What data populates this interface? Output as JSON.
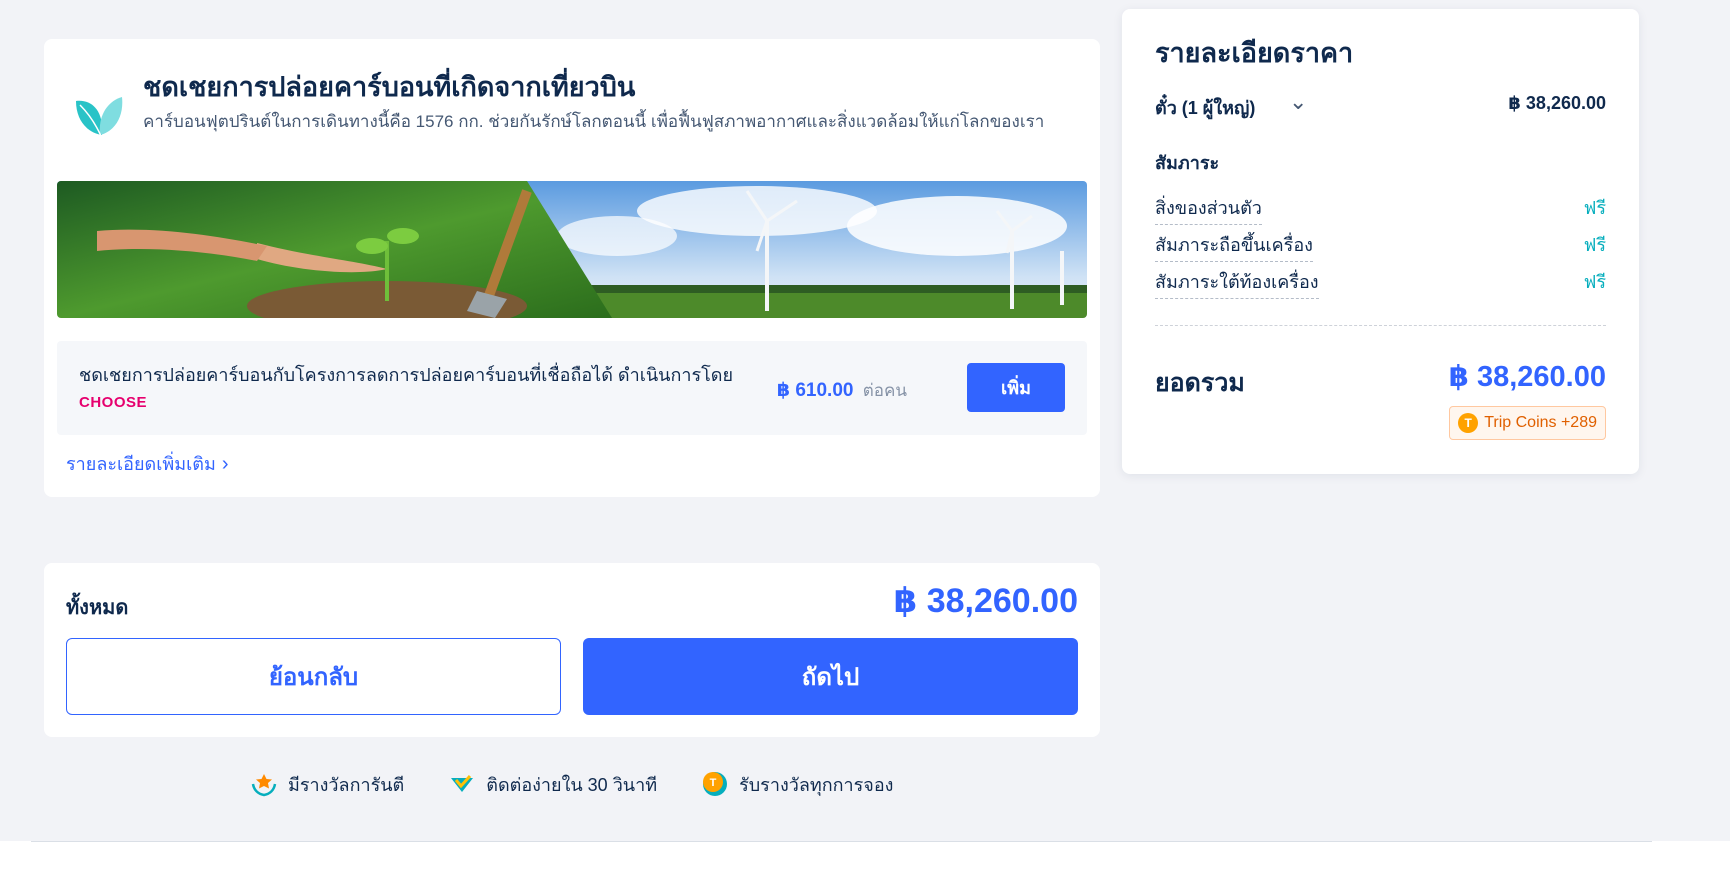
{
  "carbon": {
    "title": "ชดเชยการปล่อยคาร์บอนที่เกิดจากเที่ยวบิน",
    "description": "คาร์บอนฟุตปรินต์ในการเดินทางนี้คือ 1576 กก. ช่วยกันรักษ์โลกตอนนี้ เพื่อฟื้นฟูสภาพอากาศและสิ่งแวดล้อมให้แก่โลกของเรา",
    "offset_text": "ชดเชยการปล่อยคาร์บอนกับโครงการลดการปล่อยคาร์บอนที่เชื่อถือได้ ดำเนินการโดย",
    "partner_logo": "CHOOSE",
    "price": "฿ 610.00",
    "per_person": "ต่อคน",
    "add_label": "เพิ่ม",
    "more_link": "รายละเอียดเพิ่มเติม"
  },
  "total": {
    "label": "ทั้งหมด",
    "amount": "฿ 38,260.00",
    "back_label": "ย้อนกลับ",
    "next_label": "ถัดไป"
  },
  "benefits": [
    {
      "icon": "award-icon",
      "label": "มีรางวัลการันตี"
    },
    {
      "icon": "heart-check-icon",
      "label": "ติดต่อง่ายใน 30 วินาที"
    },
    {
      "icon": "trip-coin-icon",
      "label": "รับรางวัลทุกการจอง"
    }
  ],
  "price_details": {
    "title": "รายละเอียดราคา",
    "ticket_label": "ตั๋ว (1 ผู้ใหญ่)",
    "ticket_price": "฿ 38,260.00",
    "baggage_heading": "สัมภาระ",
    "baggage": [
      {
        "label": "สิ่งของส่วนตัว",
        "value": "ฟรี"
      },
      {
        "label": "สัมภาระถือขึ้นเครื่อง",
        "value": "ฟรี"
      },
      {
        "label": "สัมภาระใต้ท้องเครื่อง",
        "value": "ฟรี"
      }
    ],
    "grand_label": "ยอดรวม",
    "grand_amount": "฿ 38,260.00",
    "coins": "Trip Coins +289"
  },
  "colors": {
    "accent": "#3264ff",
    "free": "#06aebd",
    "background": "#f2f3f7",
    "brand_choose": "#e6006e"
  }
}
